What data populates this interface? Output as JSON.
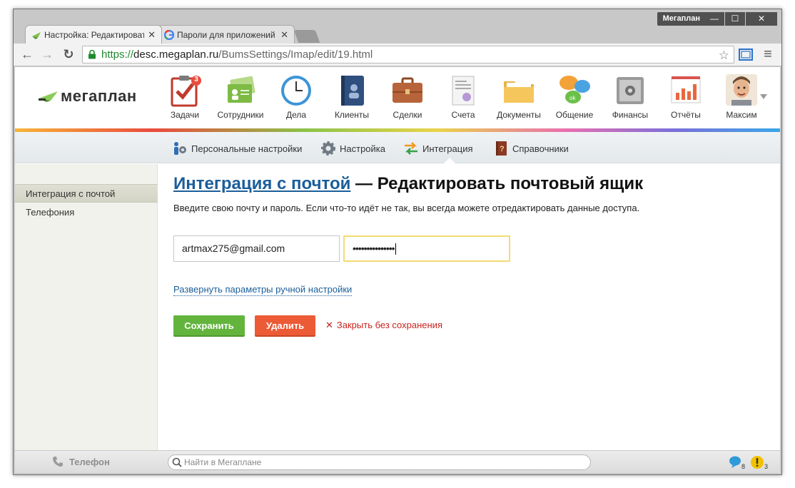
{
  "window": {
    "user_label": "Мегаплан",
    "min_glyph": "—",
    "max_glyph": "☐",
    "close_glyph": "✕"
  },
  "tabs": [
    {
      "title": "Настройка: Редактироват",
      "close": "✕",
      "icon": "megaplan-favicon"
    },
    {
      "title": "Пароли для приложений",
      "close": "✕",
      "icon": "google-favicon"
    }
  ],
  "toolbar": {
    "back": "←",
    "forward": "→",
    "reload": "↻",
    "url_scheme": "https://",
    "url_host": "desc.megaplan.ru",
    "url_path": "/BumsSettings/Imap/edit/19.html",
    "bookmark_star": "☆",
    "menu_glyph": "≡"
  },
  "app": {
    "logo_text": "мегаплан",
    "modules": [
      {
        "label": "Задачи",
        "icon": "tasks-icon",
        "badge": "3"
      },
      {
        "label": "Сотрудники",
        "icon": "employees-icon"
      },
      {
        "label": "Дела",
        "icon": "clock-icon"
      },
      {
        "label": "Клиенты",
        "icon": "clients-icon"
      },
      {
        "label": "Сделки",
        "icon": "deals-icon"
      },
      {
        "label": "Счета",
        "icon": "invoices-icon"
      },
      {
        "label": "Документы",
        "icon": "documents-icon"
      },
      {
        "label": "Общение",
        "icon": "chat-icon"
      },
      {
        "label": "Финансы",
        "icon": "safe-icon"
      },
      {
        "label": "Отчёты",
        "icon": "reports-icon"
      }
    ],
    "user": {
      "name": "Максим",
      "icon": "avatar"
    },
    "subnav": [
      {
        "label": "Персональные настройки",
        "icon": "personal-settings-icon"
      },
      {
        "label": "Настройка",
        "icon": "gear-icon"
      },
      {
        "label": "Интеграция",
        "icon": "integration-arrows-icon"
      },
      {
        "label": "Справочники",
        "icon": "reference-book-icon"
      }
    ],
    "sidebar": [
      {
        "label": "Интеграция с почтой",
        "active": true
      },
      {
        "label": "Телефония",
        "active": false
      }
    ],
    "main": {
      "title_link": "Интеграция с почтой",
      "title_rest": " — Редактировать почтовый ящик",
      "intro": "Введите свою почту и пароль. Если что-то идёт не так, вы всегда можете отредактировать данные доступа.",
      "email_value": "artmax275@gmail.com",
      "password_value": "•••••••••••••••",
      "manual_link": "Развернуть параметры ручной настройки",
      "save_label": "Сохранить",
      "delete_label": "Удалить",
      "close_label": "Закрыть без сохранения",
      "close_glyph": "✕"
    },
    "bottom": {
      "phone_label": "Телефон",
      "search_placeholder": "Найти в Мегаплане",
      "chat_count": "8",
      "alert_count": "3"
    }
  }
}
